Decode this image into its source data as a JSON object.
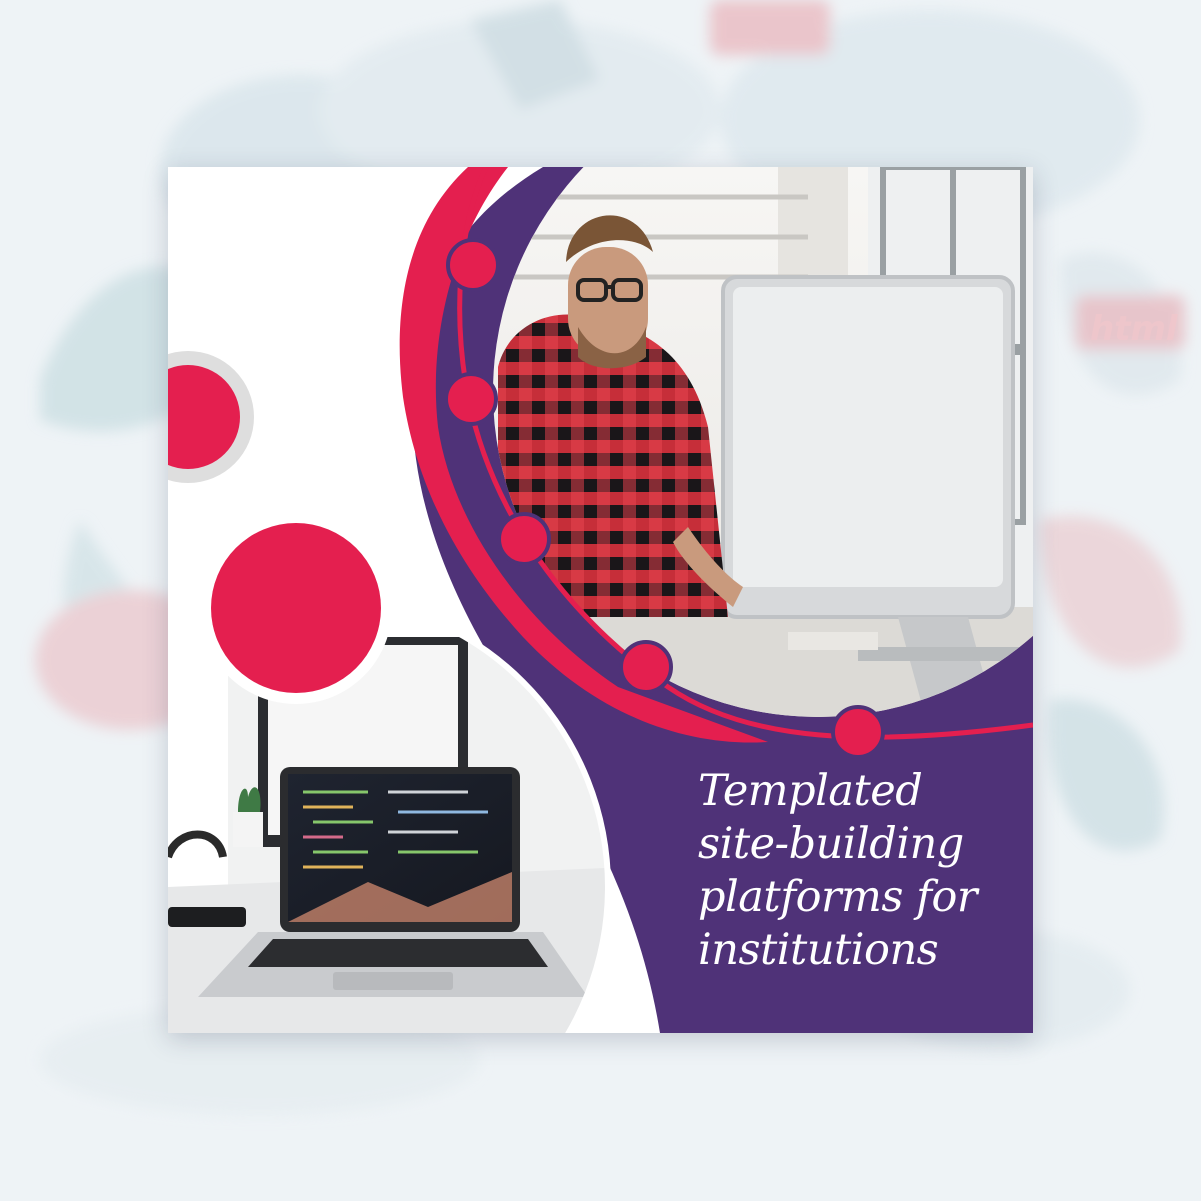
{
  "headline": {
    "lines": [
      "Templated",
      "site-building",
      "platforms for",
      "institutions"
    ]
  },
  "colors": {
    "background": "#eef3f6",
    "purple": "#4f3278",
    "crimson": "#e41f4f",
    "white": "#ffffff"
  },
  "icons": {
    "logo_badge": "html-badge-icon"
  }
}
